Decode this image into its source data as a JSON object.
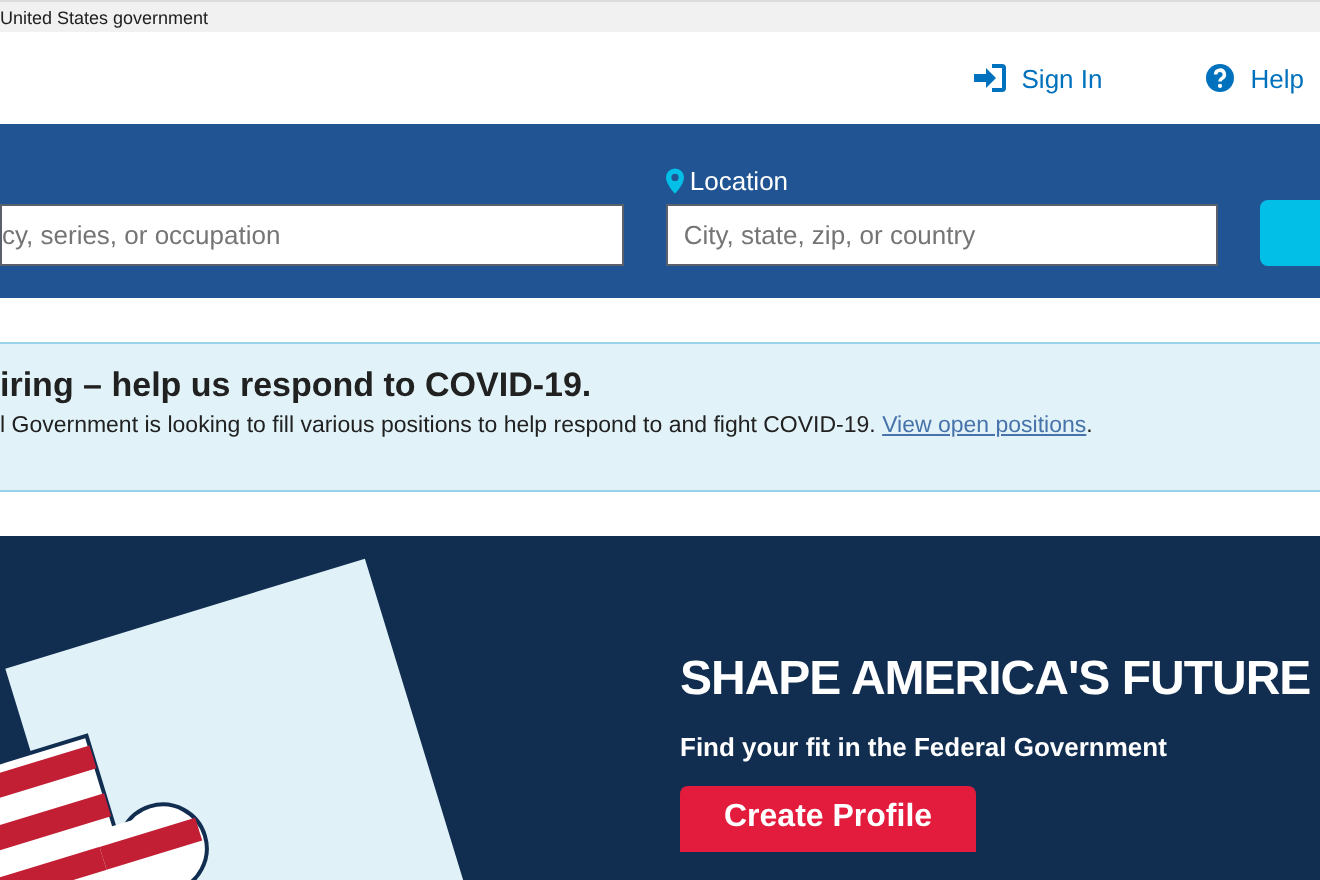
{
  "gov_banner": {
    "text": "United States government"
  },
  "header": {
    "links": [
      {
        "kind": "sign-in",
        "label": "Sign In"
      },
      {
        "kind": "help",
        "label": "Help"
      }
    ]
  },
  "search": {
    "keyword_field": {
      "placeholder": "cy, series, or occupation"
    },
    "location": {
      "label": "Location",
      "placeholder": "City, state, zip, or country"
    }
  },
  "alert": {
    "title": "iring – help us respond to COVID-19.",
    "body": "l Government is looking to fill various positions to help respond to and fight COVID-19.",
    "link": "View open positions",
    "end": "."
  },
  "hero": {
    "title": "SHAPE AMERICA'S FUTURE",
    "subtitle": "Find your fit in the Federal Government",
    "button": "Create Profile"
  }
}
